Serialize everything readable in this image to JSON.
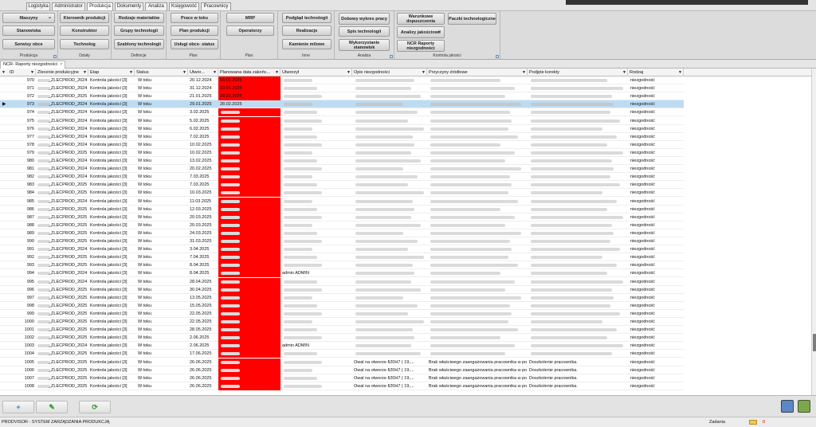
{
  "top_tabs": [
    {
      "label": "Logistyka"
    },
    {
      "label": "Administrator"
    },
    {
      "label": "Produkcja"
    },
    {
      "label": "Dokumenty"
    },
    {
      "label": "Analiza"
    },
    {
      "label": "Księgowość"
    },
    {
      "label": "Pracownicy"
    }
  ],
  "ribbon": {
    "produkcja": {
      "name": "Produkcja",
      "btn1": "Maszyny",
      "btn2": "Stanowiska",
      "btn3": "Serwisy obce"
    },
    "dzialy": {
      "name": "Działy",
      "btn1": "Kierownik produkcji",
      "btn2": "Konstruktor",
      "btn3": "Technolog"
    },
    "definicje": {
      "name": "Definicje",
      "btn1": "Rodzaje materiałów",
      "btn2": "Grupy technologii",
      "btn3": "Szablony technologii"
    },
    "plan": {
      "name": "Plan",
      "btn1": "Prace w toku",
      "btn2": "Plan produkcji",
      "btn3": "Usługi obce- status"
    },
    "plan2": {
      "name": "Plan",
      "btn1": "MRP",
      "btn2": "Operatorzy"
    },
    "inne": {
      "name": "Inne",
      "btn1": "Podgląd technologii",
      "btn2": "Realizacje",
      "btn3": "Kamienie milowe"
    },
    "analiza": {
      "name": "Analiza",
      "btn1": "Dobowy wykres pracy",
      "btn2": "Spis technologii",
      "btn3": "Wykorzystanie stanowisk"
    },
    "kontrola": {
      "name": "Kontrola jakości",
      "btn1": "Warunkowe dopuszczenia",
      "btn2": "Analizy jakościowe",
      "btn3": "NCR Raporty niezgodności"
    },
    "paczki": {
      "btn1": "Paczki technologiczne"
    }
  },
  "doc_tab": {
    "label": "NCR- Raporty niezgodności",
    "close": "×"
  },
  "grid": {
    "columns": [
      "ID",
      "Zlecenie produkcyjne",
      "Etap",
      "Status",
      "Utwor...",
      "Planowana data zakońc...",
      "Utworzył",
      "Opis niezgodności",
      "Przyczyny źródłowe",
      "Podjęte korekty",
      "Rodzaj"
    ],
    "rows": [
      {
        "id": "970",
        "zlec": "_ZLECPROD_2024",
        "etap": "Kontrola jakości [3]",
        "status": "W toku",
        "utw": "20.12.2024",
        "plan": "03.01.2025",
        "by": "",
        "opis": "",
        "przy": "",
        "kor": "",
        "rodz": "niezgodność"
      },
      {
        "id": "971",
        "zlec": "_ZLECPROD_2024",
        "etap": "Kontrola jakości [3]",
        "status": "W toku",
        "utw": "31.12.2024",
        "plan": "10.01.2025",
        "by": "",
        "opis": "",
        "przy": "",
        "kor": "",
        "rodz": "niezgodność"
      },
      {
        "id": "972",
        "zlec": "_ZLECPROD_2025",
        "etap": "Kontrola jakości [3]",
        "status": "W toku",
        "utw": "21.01.2025",
        "plan": "28.02.2025",
        "by": "",
        "opis": "",
        "przy": "",
        "kor": "",
        "rodz": "niezgodność"
      },
      {
        "id": "973",
        "zlec": "_ZLECPROD_2024",
        "etap": "Kontrola jakości [3]",
        "status": "W toku",
        "utw": "29.01.2025",
        "plan": "28.02.2025",
        "by": "",
        "opis": "",
        "przy": "",
        "kor": "",
        "rodz": "niezgodność"
      },
      {
        "id": "974",
        "zlec": "_ZLECPROD_2024",
        "etap": "Kontrola jakości [3]",
        "status": "W toku",
        "utw": "3.02.2025",
        "plan": "",
        "by": "",
        "opis": "",
        "przy": "",
        "kor": "",
        "rodz": "niezgodność"
      },
      {
        "id": "975",
        "zlec": "_ZLECPROD_2024",
        "etap": "Kontrola jakości [3]",
        "status": "W toku",
        "utw": "5.02.2025",
        "plan": "",
        "by": "",
        "opis": "",
        "przy": "",
        "kor": "",
        "rodz": "niezgodność"
      },
      {
        "id": "976",
        "zlec": "_ZLECPROD_2024",
        "etap": "Kontrola jakości [3]",
        "status": "W toku",
        "utw": "6.02.2025",
        "plan": "",
        "by": "",
        "opis": "",
        "przy": "",
        "kor": "",
        "rodz": "niezgodność"
      },
      {
        "id": "977",
        "zlec": "_ZLECPROD_2024",
        "etap": "Kontrola jakości [3]",
        "status": "W toku",
        "utw": "7.02.2025",
        "plan": "",
        "by": "",
        "opis": "",
        "przy": "",
        "kor": "",
        "rodz": "niezgodność"
      },
      {
        "id": "978",
        "zlec": "_ZLECPROD_2024",
        "etap": "Kontrola jakości [3]",
        "status": "W toku",
        "utw": "10.02.2025",
        "plan": "",
        "by": "",
        "opis": "",
        "przy": "",
        "kor": "",
        "rodz": "niezgodność"
      },
      {
        "id": "979",
        "zlec": "_ZLECPROD_2025",
        "etap": "Kontrola jakości [3]",
        "status": "W toku",
        "utw": "10.02.2025",
        "plan": "",
        "by": "",
        "opis": "",
        "przy": "",
        "kor": "",
        "rodz": "niezgodność"
      },
      {
        "id": "980",
        "zlec": "_ZLECPROD_2024",
        "etap": "Kontrola jakości [3]",
        "status": "W toku",
        "utw": "13.02.2025",
        "plan": "",
        "by": "",
        "opis": "",
        "przy": "",
        "kor": "",
        "rodz": "niezgodność"
      },
      {
        "id": "981",
        "zlec": "_ZLECPROD_2024",
        "etap": "Kontrola jakości [3]",
        "status": "W toku",
        "utw": "20.02.2025",
        "plan": "",
        "by": "",
        "opis": "",
        "przy": "",
        "kor": "",
        "rodz": "niezgodność"
      },
      {
        "id": "982",
        "zlec": "_ZLECPROD_2024",
        "etap": "Kontrola jakości [3]",
        "status": "W toku",
        "utw": "7.03.2025",
        "plan": "",
        "by": "",
        "opis": "",
        "przy": "",
        "kor": "",
        "rodz": "niezgodność"
      },
      {
        "id": "983",
        "zlec": "_ZLECPROD_2025",
        "etap": "Kontrola jakości [3]",
        "status": "W toku",
        "utw": "7.03.2025",
        "plan": "",
        "by": "",
        "opis": "",
        "przy": "",
        "kor": "",
        "rodz": "niezgodność"
      },
      {
        "id": "984",
        "zlec": "_ZLECPROD_2025",
        "etap": "Kontrola jakości [3]",
        "status": "W toku",
        "utw": "10.03.2025",
        "plan": "",
        "by": "",
        "opis": "",
        "przy": "",
        "kor": "",
        "rodz": "niezgodność"
      },
      {
        "id": "985",
        "zlec": "_ZLECPROD_2024",
        "etap": "Kontrola jakości [3]",
        "status": "W toku",
        "utw": "11.03.2025",
        "plan": "",
        "by": "",
        "opis": "",
        "przy": "",
        "kor": "",
        "rodz": "niezgodność"
      },
      {
        "id": "986",
        "zlec": "_ZLECPROD_2025",
        "etap": "Kontrola jakości [3]",
        "status": "W toku",
        "utw": "12.03.2025",
        "plan": "",
        "by": "",
        "opis": "",
        "przy": "",
        "kor": "",
        "rodz": "niezgodność"
      },
      {
        "id": "987",
        "zlec": "_ZLECPROD_2025",
        "etap": "Kontrola jakości [3]",
        "status": "W toku",
        "utw": "20.03.2025",
        "plan": "",
        "by": "",
        "opis": "",
        "przy": "",
        "kor": "",
        "rodz": "niezgodność"
      },
      {
        "id": "988",
        "zlec": "_ZLECPROD_2025",
        "etap": "Kontrola jakości [3]",
        "status": "W toku",
        "utw": "20.03.2025",
        "plan": "",
        "by": "",
        "opis": "",
        "przy": "",
        "kor": "",
        "rodz": "niezgodność"
      },
      {
        "id": "989",
        "zlec": "_ZLECPROD_2025",
        "etap": "Kontrola jakości [3]",
        "status": "W toku",
        "utw": "24.03.2025",
        "plan": "",
        "by": "",
        "opis": "",
        "przy": "",
        "kor": "",
        "rodz": "niezgodność"
      },
      {
        "id": "990",
        "zlec": "_ZLECPROD_2025",
        "etap": "Kontrola jakości [3]",
        "status": "W toku",
        "utw": "31.03.2025",
        "plan": "",
        "by": "",
        "opis": "",
        "przy": "",
        "kor": "",
        "rodz": "niezgodność"
      },
      {
        "id": "991",
        "zlec": "_ZLECPROD_2024",
        "etap": "Kontrola jakości [3]",
        "status": "W toku",
        "utw": "3.04.2025",
        "plan": "",
        "by": "",
        "opis": "",
        "przy": "",
        "kor": "",
        "rodz": "niezgodność"
      },
      {
        "id": "992",
        "zlec": "_ZLECPROD_2025",
        "etap": "Kontrola jakości [3]",
        "status": "W toku",
        "utw": "7.04.2025",
        "plan": "",
        "by": "",
        "opis": "",
        "przy": "",
        "kor": "",
        "rodz": "niezgodność"
      },
      {
        "id": "993",
        "zlec": "_ZLECPROD_2025",
        "etap": "Kontrola jakości [3]",
        "status": "W toku",
        "utw": "8.04.2025",
        "plan": "",
        "by": "",
        "opis": "",
        "przy": "",
        "kor": "",
        "rodz": "niezgodność"
      },
      {
        "id": "994",
        "zlec": "_ZLECPROD_2024",
        "etap": "Kontrola jakości [3]",
        "status": "W toku",
        "utw": "8.04.2025",
        "plan": "",
        "by": "admin ADMIN",
        "opis": "",
        "przy": "",
        "kor": "",
        "rodz": "niezgodność"
      },
      {
        "id": "995",
        "zlec": "_ZLECPROD_2024",
        "etap": "Kontrola jakości [3]",
        "status": "W toku",
        "utw": "28.04.2025",
        "plan": "",
        "by": "",
        "opis": "",
        "przy": "",
        "kor": "",
        "rodz": "niezgodność"
      },
      {
        "id": "996",
        "zlec": "_ZLECPROD_2025",
        "etap": "Kontrola jakości [3]",
        "status": "W toku",
        "utw": "30.04.2025",
        "plan": "",
        "by": "",
        "opis": "",
        "przy": "",
        "kor": "",
        "rodz": "niezgodność"
      },
      {
        "id": "997",
        "zlec": "_ZLECPROD_2025",
        "etap": "Kontrola jakości [3]",
        "status": "W toku",
        "utw": "13.05.2025",
        "plan": "",
        "by": "",
        "opis": "",
        "przy": "",
        "kor": "",
        "rodz": "niezgodność"
      },
      {
        "id": "998",
        "zlec": "_ZLECPROD_2025",
        "etap": "Kontrola jakości [3]",
        "status": "W toku",
        "utw": "15.05.2025",
        "plan": "",
        "by": "",
        "opis": "",
        "przy": "",
        "kor": "",
        "rodz": "niezgodność"
      },
      {
        "id": "999",
        "zlec": "_ZLECPROD_2025",
        "etap": "Kontrola jakości [3]",
        "status": "W toku",
        "utw": "22.05.2025",
        "plan": "",
        "by": "",
        "opis": "",
        "przy": "",
        "kor": "",
        "rodz": "niezgodność"
      },
      {
        "id": "1000",
        "zlec": "_ZLECPROD_2025",
        "etap": "Kontrola jakości [3]",
        "status": "W toku",
        "utw": "22.05.2025",
        "plan": "",
        "by": "",
        "opis": "",
        "przy": "",
        "kor": "",
        "rodz": "niezgodność"
      },
      {
        "id": "1001",
        "zlec": "_ZLECPROD_2025",
        "etap": "Kontrola jakości [3]",
        "status": "W toku",
        "utw": "28.05.2025",
        "plan": "",
        "by": "",
        "opis": "",
        "przy": "",
        "kor": "",
        "rodz": "niezgodność"
      },
      {
        "id": "1002",
        "zlec": "_ZLECPROD_2025",
        "etap": "Kontrola jakości [3]",
        "status": "W toku",
        "utw": "2.06.2025",
        "plan": "",
        "by": "",
        "opis": "",
        "przy": "",
        "kor": "",
        "rodz": "niezgodność"
      },
      {
        "id": "1003",
        "zlec": "_ZLECPROD_2024",
        "etap": "Kontrola jakości [3]",
        "status": "W toku",
        "utw": "2.06.2025",
        "plan": "",
        "by": "admin ADMIN",
        "opis": "",
        "przy": "",
        "kor": "",
        "rodz": "niezgodność"
      },
      {
        "id": "1004",
        "zlec": "_ZLECPROD_2025",
        "etap": "Kontrola jakości [3]",
        "status": "W toku",
        "utw": "17.06.2025",
        "plan": "",
        "by": "",
        "opis": "",
        "przy": "",
        "kor": "",
        "rodz": "niezgodność"
      },
      {
        "id": "1005",
        "zlec": "_ZLECPROD_2025",
        "etap": "Kontrola jakości [3]",
        "status": "W toku",
        "utw": "26.06.2025",
        "plan": "",
        "by": "",
        "opis": "Owal na otworze fi20H7 ( 19,...",
        "przy": "Brak właściwego zaangażowania pracownika w po...",
        "kor": "Doszkolenie pracownika.",
        "rodz": "niezgodność"
      },
      {
        "id": "1006",
        "zlec": "_ZLECPROD_2025",
        "etap": "Kontrola jakości [3]",
        "status": "W toku",
        "utw": "26.06.2025",
        "plan": "",
        "by": "",
        "opis": "Owal na otworze fi20H7 ( 19,...",
        "przy": "Brak właściwego zaangażowania pracownika w po...",
        "kor": "Doszkolenie pracownika.",
        "rodz": "niezgodność"
      },
      {
        "id": "1007",
        "zlec": "_ZLECPROD_2025",
        "etap": "Kontrola jakości [3]",
        "status": "W toku",
        "utw": "26.06.2025",
        "plan": "",
        "by": "",
        "opis": "Owal na otworze fi20H7 ( 19,...",
        "przy": "Brak właściwego zaangażowania pracownika w po...",
        "kor": "Doszkolenie pracownika.",
        "rodz": "niezgodność"
      },
      {
        "id": "1008",
        "zlec": "_ZLECPROD_2025",
        "etap": "Kontrola jakości [3]",
        "status": "W toku",
        "utw": "26.06.2025",
        "plan": "",
        "by": "",
        "opis": "Owal na otworze fi20H7 ( 19,...",
        "przy": "Brak właściwego zaangażowania pracownika w po...",
        "kor": "Doszkolenie pracownika.",
        "rodz": "niezgodność"
      }
    ]
  },
  "selected_row_index": 3,
  "bottom": {
    "add_icon": "plus-icon",
    "edit_icon": "pencil-icon",
    "refresh_icon": "refresh-icon"
  },
  "status": {
    "app": "PRODVISOR - SYSTEM ZARZĄDZANIA PRODUKCJĄ",
    "zadania": "Zadania",
    "count": "0"
  },
  "colors": {
    "overdue": "#ff0000",
    "selected": "#bcdcf3"
  }
}
